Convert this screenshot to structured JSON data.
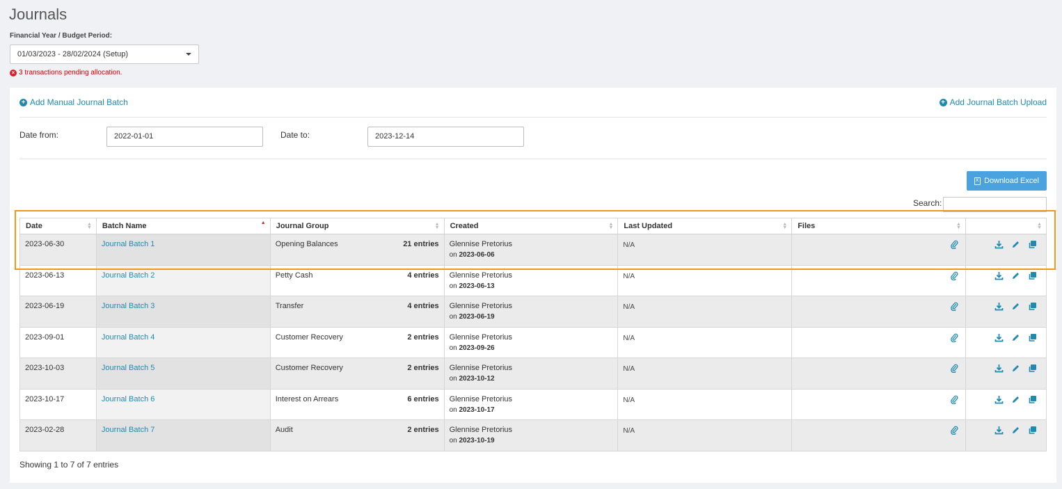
{
  "page": {
    "title": "Journals",
    "fy_label": "Financial Year / Budget Period:",
    "fy_value": "01/03/2023 - 28/02/2024 (Setup)",
    "pending_text": "3 transactions pending allocation."
  },
  "actions": {
    "add_manual": "Add Manual Journal Batch",
    "add_upload": "Add Journal Batch Upload",
    "download_excel": "Download Excel"
  },
  "filters": {
    "date_from_label": "Date from:",
    "date_from_value": "2022-01-01",
    "date_to_label": "Date to:",
    "date_to_value": "2023-12-14",
    "search_label": "Search:"
  },
  "table": {
    "headers": [
      "Date",
      "Batch Name",
      "Journal Group",
      "Created",
      "Last Updated",
      "Files",
      ""
    ],
    "rows": [
      {
        "date": "2023-06-30",
        "batch": "Journal Batch 1",
        "group": "Opening Balances",
        "entries": "21 entries",
        "created_by": "Glennise Pretorius",
        "created_on_prefix": "on",
        "created_on": "2023-06-06",
        "last_updated": "N/A"
      },
      {
        "date": "2023-06-13",
        "batch": "Journal Batch 2",
        "group": "Petty Cash",
        "entries": "4 entries",
        "created_by": "Glennise Pretorius",
        "created_on_prefix": "on",
        "created_on": "2023-06-13",
        "last_updated": "N/A"
      },
      {
        "date": "2023-06-19",
        "batch": "Journal Batch 3",
        "group": "Transfer",
        "entries": "4 entries",
        "created_by": "Glennise Pretorius",
        "created_on_prefix": "on",
        "created_on": "2023-06-19",
        "last_updated": "N/A"
      },
      {
        "date": "2023-09-01",
        "batch": "Journal Batch 4",
        "group": "Customer Recovery",
        "entries": "2 entries",
        "created_by": "Glennise Pretorius",
        "created_on_prefix": "on",
        "created_on": "2023-09-26",
        "last_updated": "N/A"
      },
      {
        "date": "2023-10-03",
        "batch": "Journal Batch 5",
        "group": "Customer Recovery",
        "entries": "2 entries",
        "created_by": "Glennise Pretorius",
        "created_on_prefix": "on",
        "created_on": "2023-10-12",
        "last_updated": "N/A"
      },
      {
        "date": "2023-10-17",
        "batch": "Journal Batch 6",
        "group": "Interest on Arrears",
        "entries": "6 entries",
        "created_by": "Glennise Pretorius",
        "created_on_prefix": "on",
        "created_on": "2023-10-17",
        "last_updated": "N/A"
      },
      {
        "date": "2023-02-28",
        "batch": "Journal Batch 7",
        "group": "Audit",
        "entries": "2 entries",
        "created_by": "Glennise Pretorius",
        "created_on_prefix": "on",
        "created_on": "2023-10-19",
        "last_updated": "N/A"
      }
    ],
    "footer": "Showing 1 to 7 of 7 entries"
  },
  "icons": {
    "attachment": "paperclip-icon",
    "download": "download-icon",
    "edit": "pencil-icon",
    "copy": "copy-icon"
  },
  "colors": {
    "link": "#1f8ab0",
    "button": "#4aa3df",
    "error": "#d9202a",
    "highlight": "#f0961e"
  }
}
